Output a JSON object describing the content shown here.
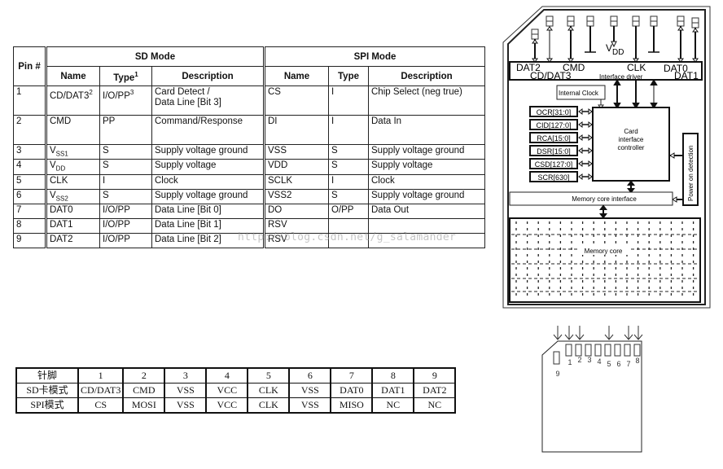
{
  "pin_table": {
    "pin_header": "Pin #",
    "sd_mode_header": "SD Mode",
    "spi_mode_header": "SPI Mode",
    "sd_columns": {
      "name": "Name",
      "type": "Type",
      "type_sup": "1",
      "description": "Description"
    },
    "spi_columns": {
      "name": "Name",
      "type": "Type",
      "description": "Description"
    },
    "rows": [
      {
        "pin": "1",
        "sd_name": "CD/DAT3",
        "sd_name_sup": "2",
        "sd_type": "I/O/PP",
        "sd_type_sup": "3",
        "sd_desc": "Card Detect /",
        "sd_desc2": "Data Line [Bit 3]",
        "spi_name": "CS",
        "spi_type": "I",
        "spi_desc": "Chip Select (neg true)"
      },
      {
        "pin": "2",
        "sd_name": "CMD",
        "sd_type": "PP",
        "sd_desc": "Command/Response",
        "spi_name": "DI",
        "spi_type": "I",
        "spi_desc": "Data In"
      },
      {
        "pin": "3",
        "sd_name": "V",
        "sd_name_sub": "SS1",
        "sd_type": "S",
        "sd_desc": "Supply voltage ground",
        "spi_name": "VSS",
        "spi_type": "S",
        "spi_desc": "Supply voltage ground"
      },
      {
        "pin": "4",
        "sd_name": "V",
        "sd_name_sub": "DD",
        "sd_type": "S",
        "sd_desc": "Supply voltage",
        "spi_name": "VDD",
        "spi_type": "S",
        "spi_desc": "Supply voltage"
      },
      {
        "pin": "5",
        "sd_name": "CLK",
        "sd_type": "I",
        "sd_desc": "Clock",
        "spi_name": "SCLK",
        "spi_type": "I",
        "spi_desc": "Clock"
      },
      {
        "pin": "6",
        "sd_name": "V",
        "sd_name_sub": "SS2",
        "sd_type": "S",
        "sd_desc": "Supply voltage ground",
        "spi_name": "VSS2",
        "spi_type": "S",
        "spi_desc": "Supply voltage ground"
      },
      {
        "pin": "7",
        "sd_name": "DAT0",
        "sd_type": "I/O/PP",
        "sd_desc": "Data Line [Bit 0]",
        "spi_name": "DO",
        "spi_type": "O/PP",
        "spi_desc": "Data Out"
      },
      {
        "pin": "8",
        "sd_name": "DAT1",
        "sd_type": "I/O/PP",
        "sd_desc": "Data Line [Bit 1]",
        "spi_name": "RSV",
        "spi_type": "",
        "spi_desc": ""
      },
      {
        "pin": "9",
        "sd_name": "DAT2",
        "sd_type": "I/O/PP",
        "sd_desc": "Data Line [Bit 2]",
        "spi_name": "RSV",
        "spi_type": "",
        "spi_desc": ""
      }
    ]
  },
  "watermark": "http://blog.csdn.net/g_salamander",
  "cn_table": {
    "row_headers": [
      "针脚",
      "SD卡模式",
      "SPI模式"
    ],
    "pins": [
      "1",
      "2",
      "3",
      "4",
      "5",
      "6",
      "7",
      "8",
      "9"
    ],
    "sd_mode": [
      "CD/DAT3",
      "CMD",
      "VSS",
      "VCC",
      "CLK",
      "VSS",
      "DAT0",
      "DAT1",
      "DAT2"
    ],
    "spi_mode": [
      "CS",
      "MOSI",
      "VSS",
      "VCC",
      "CLK",
      "VSS",
      "MISO",
      "NC",
      "NC"
    ]
  },
  "block_diagram": {
    "pin_labels_top": [
      "DAT2",
      "CMD",
      "CLK",
      "DAT0"
    ],
    "pin_labels_bottom": [
      "CD/DAT3",
      "DAT1"
    ],
    "vdd_label": "V",
    "vdd_sub": "DD",
    "interface_driver": "Interface driver",
    "internal_clock": "Internal Clock",
    "registers": [
      "OCR[31:0]",
      "CID[127:0]",
      "RCA[15:0]",
      "DSR[15:0]",
      "CSD[127:0]",
      "SCR[630]"
    ],
    "controller": [
      "Card",
      "interface",
      "controller"
    ],
    "power_on_detection": "Power on detection",
    "memory_core_interface": "Memory core interface",
    "memory_core": "Memory core"
  },
  "connector_diagram": {
    "pin_numbers": [
      "1",
      "2",
      "3",
      "4",
      "5",
      "6",
      "7",
      "8",
      "9"
    ]
  }
}
